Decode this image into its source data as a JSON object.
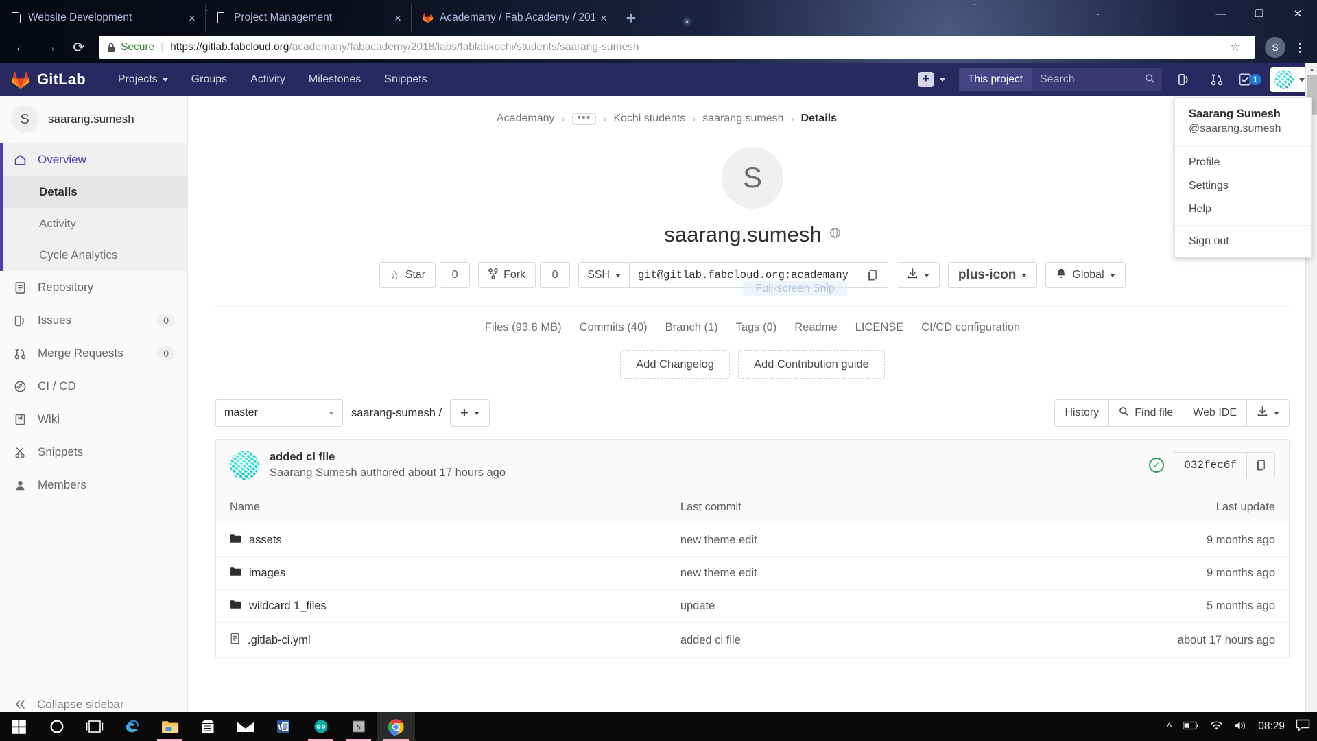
{
  "browser": {
    "tabs": [
      {
        "title": "Website Development",
        "favicon": "document-icon",
        "close": "×"
      },
      {
        "title": "Project Management",
        "favicon": "document-icon",
        "close": "×"
      },
      {
        "title": "Academany / Fab Academy / 201",
        "favicon": "gitlab-icon",
        "close": "×"
      }
    ],
    "new_tab_label": "+",
    "window_controls": {
      "minimize": "—",
      "maximize": "❐",
      "close": "✕"
    },
    "nav": {
      "back": "←",
      "forward": "→",
      "reload": "⟳"
    },
    "omnibox": {
      "security_label": "Secure",
      "separator": "|",
      "url_scheme": "https://",
      "url_host": "gitlab.fabcloud.org",
      "url_path": "/academany/fabacademy/2018/labs/fablabkochi/students/saarang-sumesh",
      "bookmark_icon": "star-icon",
      "profile_initial": "S"
    }
  },
  "gitlab_nav": {
    "brand": "GitLab",
    "items": [
      {
        "label": "Projects",
        "has_caret": true
      },
      {
        "label": "Groups",
        "has_caret": false
      },
      {
        "label": "Activity",
        "has_caret": false
      },
      {
        "label": "Milestones",
        "has_caret": false
      },
      {
        "label": "Snippets",
        "has_caret": false
      }
    ],
    "search_scope": "This project",
    "search_placeholder": "Search",
    "todos_count": "1",
    "plus_label": "+"
  },
  "user_menu": {
    "name": "Saarang Sumesh",
    "handle": "@saarang.sumesh",
    "items": [
      "Profile",
      "Settings",
      "Help"
    ],
    "signout": "Sign out"
  },
  "sidebar": {
    "project_initial": "S",
    "project_name": "saarang.sumesh",
    "overview_label": "Overview",
    "overview_children": [
      {
        "label": "Details",
        "selected": true
      },
      {
        "label": "Activity",
        "selected": false
      },
      {
        "label": "Cycle Analytics",
        "selected": false
      }
    ],
    "items": [
      {
        "label": "Repository",
        "icon": "document-icon",
        "count": null
      },
      {
        "label": "Issues",
        "icon": "issues-icon",
        "count": "0"
      },
      {
        "label": "Merge Requests",
        "icon": "merge-request-icon",
        "count": "0"
      },
      {
        "label": "CI / CD",
        "icon": "rocket-icon",
        "count": null
      },
      {
        "label": "Wiki",
        "icon": "book-icon",
        "count": null
      },
      {
        "label": "Snippets",
        "icon": "scissors-icon",
        "count": null
      },
      {
        "label": "Members",
        "icon": "user-icon",
        "count": null
      }
    ],
    "collapse_label": "Collapse sidebar"
  },
  "breadcrumb": {
    "items": [
      "Academany",
      "•••",
      "Kochi students",
      "saarang.sumesh",
      "Details"
    ],
    "separator": "›"
  },
  "project": {
    "avatar_initial": "S",
    "title": "saarang.sumesh",
    "visibility_icon": "globe-icon",
    "star_label": "Star",
    "star_count": "0",
    "fork_label": "Fork",
    "fork_count": "0",
    "clone_protocol": "SSH",
    "clone_url": "git@gitlab.fabcloud.org:academany",
    "copy_icon": "copy-icon",
    "download_icon": "download-icon",
    "add_icon": "plus-icon",
    "notification_label": "Global",
    "notification_icon": "bell-icon",
    "snip_overlay_text": "Full-screen Snip"
  },
  "stats": [
    "Files (93.8 MB)",
    "Commits (40)",
    "Branch (1)",
    "Tags (0)",
    "Readme",
    "LICENSE",
    "CI/CD configuration"
  ],
  "ghost_buttons": [
    "Add Changelog",
    "Add Contribution guide"
  ],
  "repo": {
    "branch": "master",
    "path_crumb": "saarang-sumesh /",
    "add_label": "+",
    "history_label": "History",
    "find_file_label": "Find file",
    "web_ide_label": "Web IDE",
    "download_icon": "download-icon"
  },
  "last_commit": {
    "message": "added ci file",
    "meta": "Saarang Sumesh authored about 17 hours ago",
    "status_icon": "pipeline-passed-icon",
    "sha": "032fec6f",
    "copy_icon": "copy-icon"
  },
  "file_table": {
    "headers": [
      "Name",
      "Last commit",
      "Last update"
    ],
    "rows": [
      {
        "name": "assets",
        "type": "folder",
        "commit": "new theme edit",
        "update": "9 months ago"
      },
      {
        "name": "images",
        "type": "folder",
        "commit": "new theme edit",
        "update": "9 months ago"
      },
      {
        "name": "wildcard 1_files",
        "type": "folder",
        "commit": "update",
        "update": "5 months ago"
      },
      {
        "name": ".gitlab-ci.yml",
        "type": "file",
        "commit": "added ci file",
        "update": "about 17 hours ago"
      }
    ]
  },
  "taskbar": {
    "items": [
      {
        "name": "start-button",
        "icon": "windows-icon"
      },
      {
        "name": "cortana-button",
        "icon": "circle-icon"
      },
      {
        "name": "task-view-button",
        "icon": "taskview-icon"
      },
      {
        "name": "edge-button",
        "icon": "edge-icon"
      },
      {
        "name": "file-explorer-button",
        "icon": "folder-icon"
      },
      {
        "name": "store-button",
        "icon": "store-icon"
      },
      {
        "name": "mail-button",
        "icon": "mail-icon"
      },
      {
        "name": "word-button",
        "icon": "word-icon"
      },
      {
        "name": "arduino-button",
        "icon": "arduino-icon"
      },
      {
        "name": "sublime-button",
        "icon": "sublime-icon"
      },
      {
        "name": "chrome-button",
        "icon": "chrome-icon"
      }
    ],
    "tray": {
      "expand_icon": "chevron-up-icon",
      "battery_icon": "battery-icon",
      "wifi_icon": "wifi-icon",
      "volume_icon": "volume-icon",
      "clock": "08:29",
      "notifications_icon": "notification-icon"
    }
  },
  "colors": {
    "gitlab_nav": "#292961",
    "accent": "#4a40a8",
    "link": "#1f78d1",
    "success": "#2d9e57",
    "orange": "#e24329"
  }
}
